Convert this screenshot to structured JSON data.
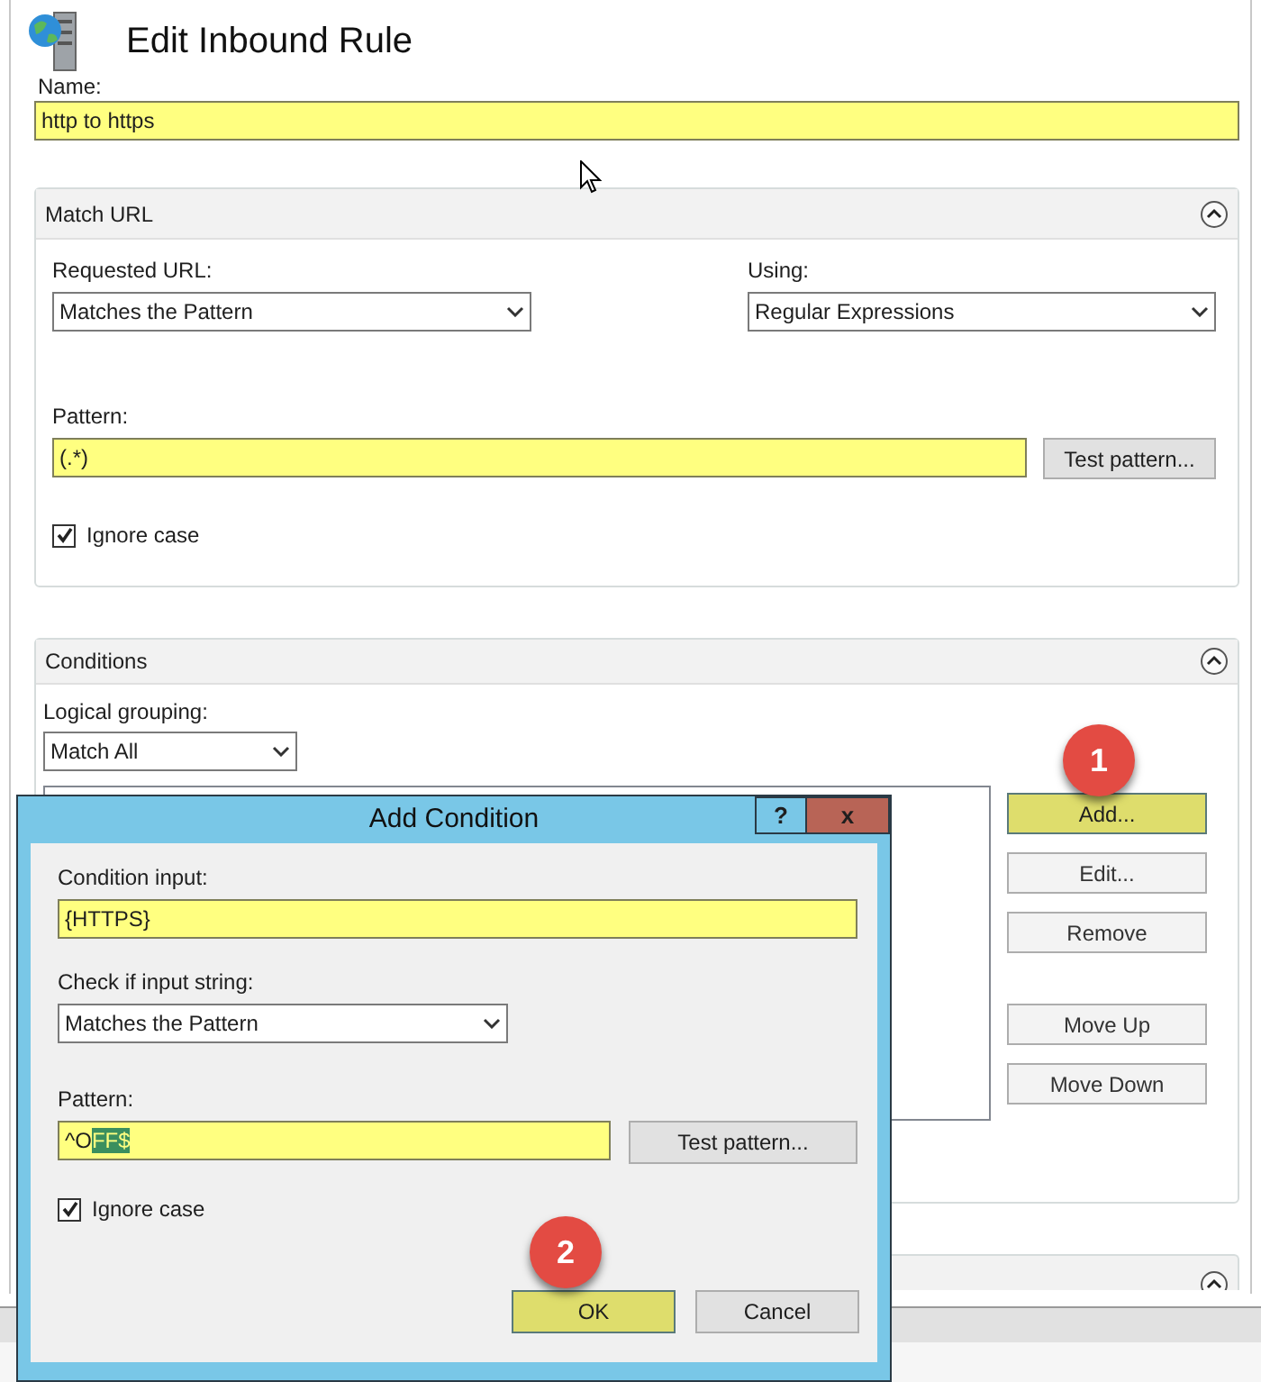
{
  "page": {
    "title": "Edit Inbound Rule"
  },
  "name_field": {
    "label": "Name:",
    "value": "http to https",
    "highlighted": true
  },
  "match_url": {
    "title": "Match URL",
    "expanded": true,
    "requested_url": {
      "label": "Requested URL:",
      "value": "Matches the Pattern"
    },
    "using": {
      "label": "Using:",
      "value": "Regular Expressions"
    },
    "pattern": {
      "label": "Pattern:",
      "value": "(.*)",
      "highlighted": true
    },
    "test_button": "Test pattern...",
    "ignore_case": {
      "label": "Ignore case",
      "checked": true
    }
  },
  "conditions": {
    "title": "Conditions",
    "expanded": true,
    "grouping": {
      "label": "Logical grouping:",
      "value": "Match All"
    },
    "buttons": [
      {
        "label": "Add...",
        "highlighted": true
      },
      {
        "label": "Edit...",
        "highlighted": false
      },
      {
        "label": "Remove",
        "highlighted": false
      },
      {
        "label": "Move Up",
        "highlighted": false
      },
      {
        "label": "Move Down",
        "highlighted": false
      }
    ]
  },
  "next_panel": {
    "expanded": true
  },
  "dialog": {
    "title": "Add Condition",
    "help_button": "?",
    "close_button": "x",
    "condition_input": {
      "label": "Condition input:",
      "value": "{HTTPS}",
      "highlighted": true
    },
    "check": {
      "label": "Check if input string:",
      "value": "Matches the Pattern"
    },
    "pattern": {
      "label": "Pattern:",
      "value": "^O",
      "selected_value": "FF$",
      "highlighted": true
    },
    "test_button": "Test pattern...",
    "ignore_case": {
      "label": "Ignore case",
      "checked": true
    },
    "buttons": [
      {
        "label": "OK",
        "highlighted": true
      },
      {
        "label": "Cancel",
        "highlighted": false
      }
    ]
  },
  "callouts": [
    {
      "label": "1"
    },
    {
      "label": "2"
    }
  ]
}
